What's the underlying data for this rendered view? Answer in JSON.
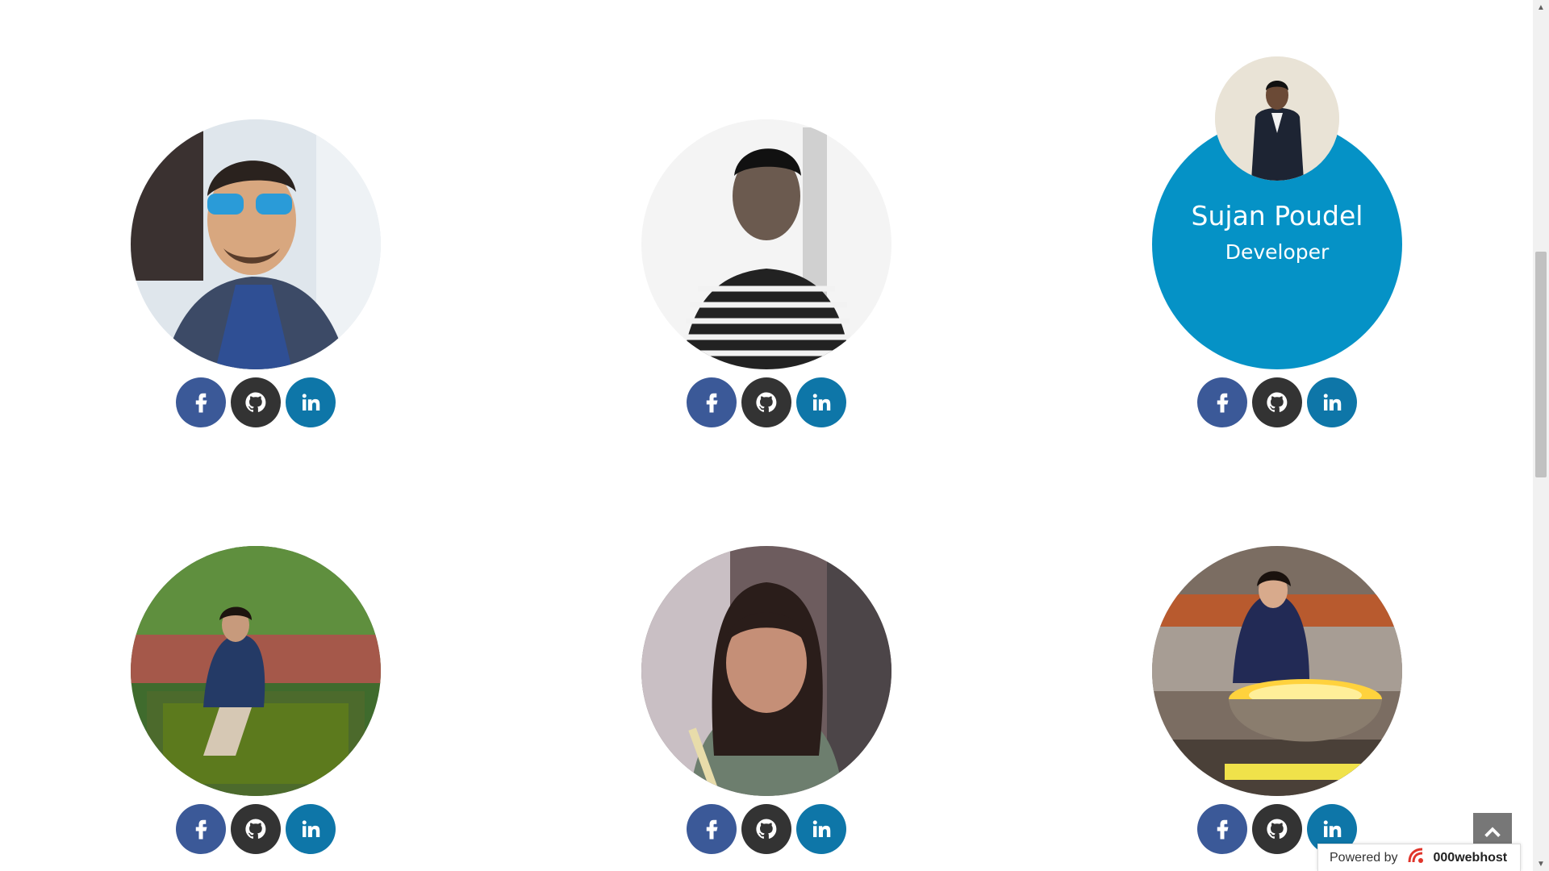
{
  "team": [
    {
      "photo": "man-sunglasses-photo",
      "name": "",
      "role": "",
      "overlay": false
    },
    {
      "photo": "man-striped-hoodie-photo",
      "name": "",
      "role": "",
      "overlay": false
    },
    {
      "photo": "man-suit-photo",
      "name": "Sujan Poudel",
      "role": "Developer",
      "overlay": true
    },
    {
      "photo": "woman-garden-pond-photo",
      "name": "",
      "role": "",
      "overlay": false
    },
    {
      "photo": "woman-portrait-photo",
      "name": "",
      "role": "",
      "overlay": false
    },
    {
      "photo": "woman-lamps-photo",
      "name": "",
      "role": "",
      "overlay": false
    }
  ],
  "social_icons": [
    "facebook-icon",
    "github-icon",
    "linkedin-icon"
  ],
  "colors": {
    "overlay": "#0592c6",
    "facebook": "#3b5998",
    "github": "#333333",
    "linkedin": "#0e76a8"
  },
  "footer": {
    "powered_label": "Powered by",
    "brand": "000webhost"
  }
}
